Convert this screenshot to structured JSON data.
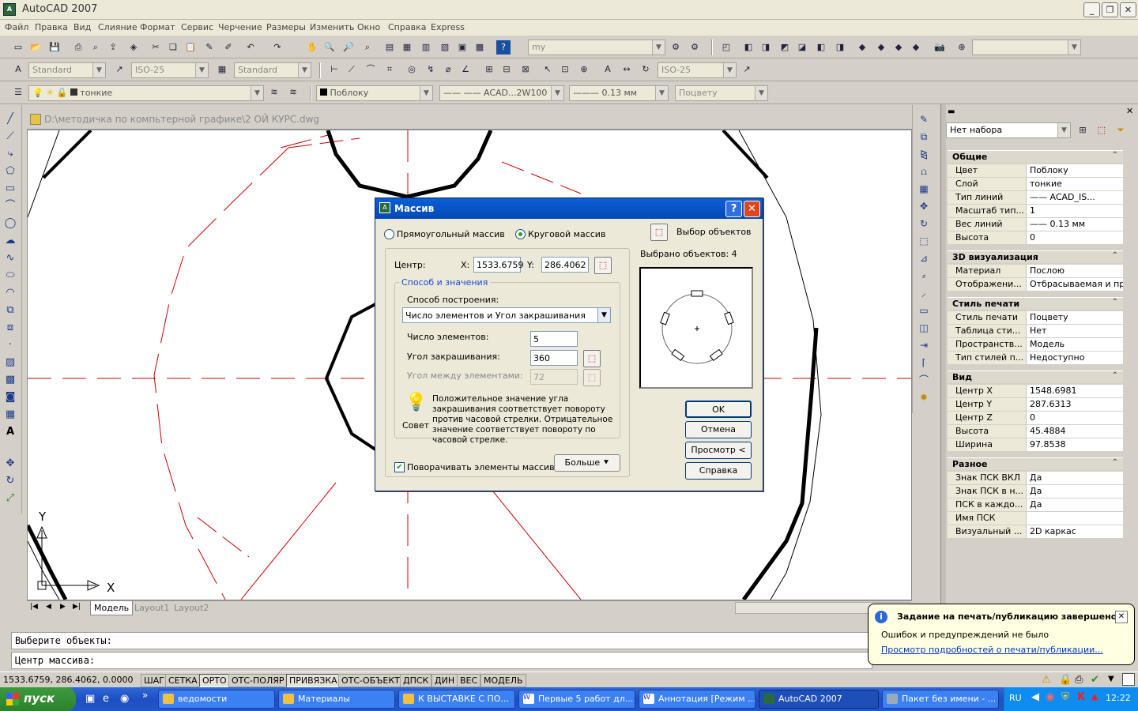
{
  "window": {
    "title": "AutoCAD 2007",
    "logo": "A"
  },
  "menu": [
    "Файл",
    "Правка",
    "Вид",
    "Слияние",
    "Формат",
    "Сервис",
    "Черчение",
    "Размеры",
    "Изменить",
    "Окно",
    "Справка",
    "Express"
  ],
  "toolbars": {
    "workspace_combo": "my",
    "text_style": "Standard",
    "dim_style": "ISO-25",
    "table_style": "Standard",
    "dim_style2": "ISO-25",
    "layer": "тонкие",
    "color": "Поблоку",
    "linetype": "ACAD...2W100",
    "lineweight": "0.13 мм",
    "plotstyle": "Поцвету"
  },
  "document": {
    "path": "D:\\методичка по компьтерной графике\\2 ОЙ КУРС.dwg"
  },
  "layout_tabs": [
    "Модель",
    "Layout1",
    "Layout2"
  ],
  "ucs": {
    "x": "X",
    "y": "Y"
  },
  "dialog": {
    "title": "Массив",
    "help_btn": "?",
    "radio_rect": "Прямоугольный массив",
    "radio_polar": "Круговой массив",
    "select_objects": "Выбор объектов",
    "selected_count": "Выбрано объектов: 4",
    "center_label": "Центр:",
    "x_label": "X:",
    "x_value": "1533.6759",
    "y_label": "Y:",
    "y_value": "286.4062",
    "group_title": "Способ и значения",
    "method_label": "Способ построения:",
    "method_value": "Число элементов и Угол закрашивания",
    "count_label": "Число элементов:",
    "count_value": "5",
    "angle_label": "Угол закрашивания:",
    "angle_value": "360",
    "between_label": "Угол между элементами:",
    "between_value": "72",
    "tip_label": "Совет",
    "tip_text": "Положительное значение угла закрашивания соответствует повороту против часовой стрелки. Отрицательное значение соответствует повороту по часовой стрелке.",
    "rotate_label": "Поворачивать элементы массива",
    "more_btn": "Больше",
    "ok_btn": "OK",
    "cancel_btn": "Отмена",
    "preview_btn": "Просмотр <",
    "help2_btn": "Справка"
  },
  "properties": {
    "selection": "Нет набора",
    "categories": [
      {
        "name": "Общие",
        "rows": [
          [
            "Цвет",
            "Поблоку"
          ],
          [
            "Слой",
            "тонкие"
          ],
          [
            "Тип линий",
            "——  ACAD_IS..."
          ],
          [
            "Масштаб тип...",
            "1"
          ],
          [
            "Вес линий",
            "——  0.13 мм"
          ],
          [
            "Высота",
            "0"
          ]
        ]
      },
      {
        "name": "3D визуализация",
        "rows": [
          [
            "Материал",
            "Послою"
          ],
          [
            "Отображени...",
            "Отбрасываемая и пр..."
          ]
        ]
      },
      {
        "name": "Стиль печати",
        "rows": [
          [
            "Стиль печати",
            "Поцвету"
          ],
          [
            "Таблица сти...",
            "Нет"
          ],
          [
            "Пространств...",
            "Модель"
          ],
          [
            "Тип стилей п...",
            "Недоступно"
          ]
        ]
      },
      {
        "name": "Вид",
        "rows": [
          [
            "Центр X",
            "1548.6981"
          ],
          [
            "Центр Y",
            "287.6313"
          ],
          [
            "Центр Z",
            "0"
          ],
          [
            "Высота",
            "45.4884"
          ],
          [
            "Ширина",
            "97.8538"
          ]
        ]
      },
      {
        "name": "Разное",
        "rows": [
          [
            "Знак ПСК ВКЛ",
            "Да"
          ],
          [
            "Знак ПСК в н...",
            "Да"
          ],
          [
            "ПСК в каждо...",
            "Да"
          ],
          [
            "Имя ПСК",
            ""
          ],
          [
            "Визуальный ...",
            "2D каркас"
          ]
        ]
      }
    ]
  },
  "command": {
    "line1": "Выберите объекты:",
    "line2": "Центр массива:"
  },
  "status": {
    "coords": "1533.6759, 286.4062, 0.0000",
    "buttons": [
      "ШАГ",
      "СЕТКА",
      "ОРТО",
      "ОТС-ПОЛЯР",
      "ПРИВЯЗКА",
      "ОТС-ОБЪЕКТ",
      "ДПСК",
      "ДИН",
      "ВЕС",
      "МОДЕЛЬ"
    ]
  },
  "balloon": {
    "title": "Задание на печать/публикацию завершено",
    "text": "Ошибок и предупреждений не было",
    "link": "Просмотр подробностей о печати/публикации..."
  },
  "taskbar": {
    "start": "пуск",
    "tasks": [
      "ведомости",
      "Материалы",
      "К ВЫСТАВКЕ С ПО...",
      "Первые 5 работ дл...",
      "Аннотация [Режим ...",
      "AutoCAD 2007",
      "Пакет без имени - ..."
    ],
    "lang": "RU",
    "clock": "12:22"
  },
  "colors": {
    "accent": "#0a5fd8",
    "red_line": "#cc0000",
    "taskbar": "#245edb"
  }
}
